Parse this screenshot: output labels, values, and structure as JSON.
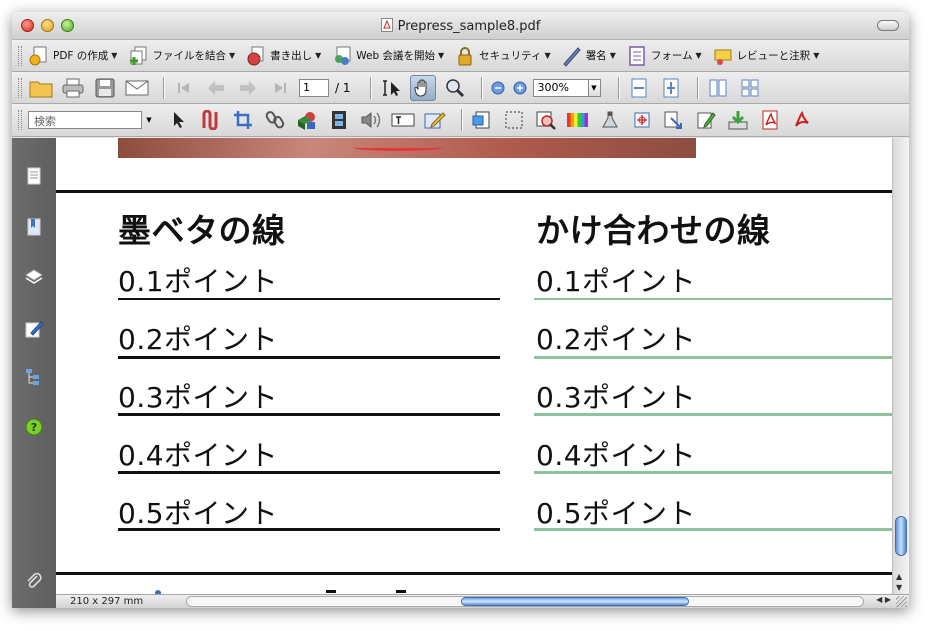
{
  "window": {
    "title": "Prepress_sample8.pdf"
  },
  "toolbar1": {
    "items": [
      {
        "label": "PDF の作成",
        "icon": "create-pdf-icon"
      },
      {
        "label": "ファイルを結合",
        "icon": "combine-files-icon"
      },
      {
        "label": "書き出し",
        "icon": "export-icon"
      },
      {
        "label": "Web 会議を開始",
        "icon": "web-meeting-icon"
      },
      {
        "label": "セキュリティ",
        "icon": "lock-icon"
      },
      {
        "label": "署名",
        "icon": "pen-icon"
      },
      {
        "label": "フォーム",
        "icon": "form-icon"
      },
      {
        "label": "レビューと注釈",
        "icon": "review-comment-icon"
      }
    ]
  },
  "toolbar2": {
    "page_current": "1",
    "page_total": "/ 1",
    "zoom": "300%"
  },
  "toolbar3": {
    "search_placeholder": "検索"
  },
  "document": {
    "left_heading": "墨ベタの線",
    "right_heading": "かけ合わせの線",
    "line_labels": [
      "0.1ポイント",
      "0.2ポイント",
      "0.3ポイント",
      "0.4ポイント",
      "0.5ポイント"
    ],
    "colors": {
      "black_line": "#111111",
      "mixed_line": "#8cc39a"
    }
  },
  "status": {
    "page_size": "210 x 297 mm"
  }
}
